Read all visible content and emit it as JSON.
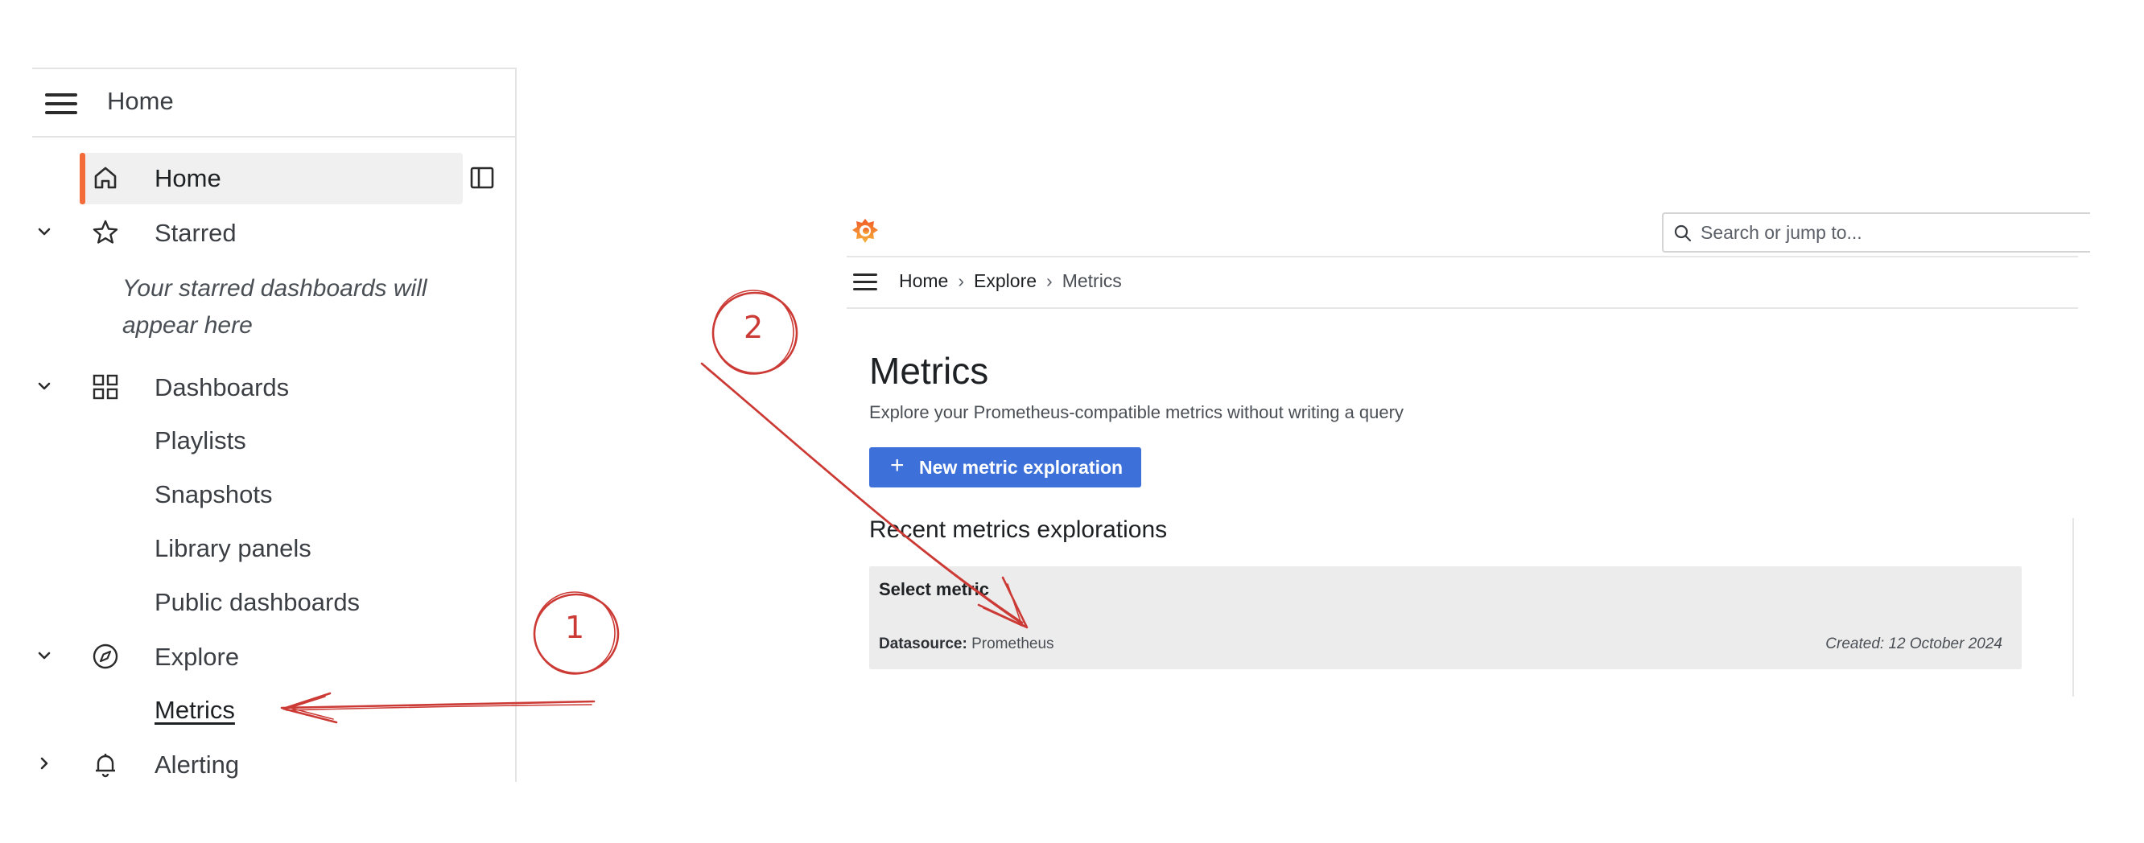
{
  "sidebar": {
    "header_title": "Home",
    "items": [
      {
        "label": "Home",
        "icon": "home-icon",
        "active": true
      },
      {
        "label": "Starred",
        "icon": "star-icon",
        "expanded": true
      },
      {
        "label": "Dashboards",
        "icon": "grid-icon",
        "expanded": true
      },
      {
        "label": "Explore",
        "icon": "compass-icon",
        "expanded": true
      },
      {
        "label": "Alerting",
        "icon": "bell-icon",
        "expanded": false
      }
    ],
    "starred_empty": "Your starred dashboards will appear here",
    "dashboards_children": [
      "Playlists",
      "Snapshots",
      "Library panels",
      "Public dashboards"
    ],
    "explore_children": [
      "Metrics"
    ],
    "accent_color": "#f46b3a"
  },
  "app": {
    "search_placeholder": "Search or jump to...",
    "breadcrumb": [
      "Home",
      "Explore",
      "Metrics"
    ],
    "page_title": "Metrics",
    "page_subtitle": "Explore your Prometheus-compatible metrics without writing a query",
    "new_button_label": "New metric exploration",
    "recent_title": "Recent metrics explorations",
    "card": {
      "title": "Select metric",
      "datasource_label": "Datasource:",
      "datasource_value": "Prometheus",
      "created": "Created: 12 October 2024"
    },
    "button_color": "#3d71d9"
  },
  "annotations": {
    "one": "1",
    "two": "2",
    "color": "#cc3a35"
  }
}
